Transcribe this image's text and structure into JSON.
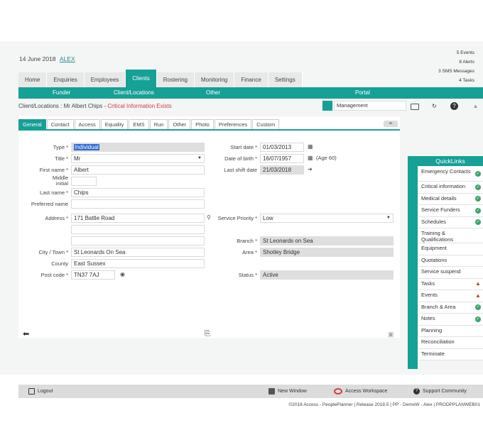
{
  "header": {
    "date": "14 June 2018",
    "user": "ALEX",
    "alerts": [
      "5 Events",
      "8 Alerts",
      "3 SMS Messages",
      "4 Tasks"
    ]
  },
  "nav": {
    "tabs": [
      "Home",
      "Enquiries",
      "Employees",
      "Clients",
      "Rostering",
      "Monitoring",
      "Finance",
      "Settings"
    ],
    "active": "Clients"
  },
  "subnav": {
    "funder": "Funder",
    "client_locations": "Client/Locations",
    "other": "Other",
    "portal": "Portal"
  },
  "breadcrumb": {
    "path": "Client/Locations : Mr Albert Chips - ",
    "critical": "Critical Information Exists"
  },
  "management": "Management",
  "subtabs": [
    "General",
    "Contact",
    "Access",
    "Equality",
    "EMS",
    "Run",
    "Other",
    "Photo",
    "Preferences",
    "Custom"
  ],
  "form": {
    "type_label": "Type *",
    "type_value": "Individual",
    "title_label": "Title *",
    "title_value": "Mr",
    "first_name_label": "First name *",
    "first_name_value": "Albert",
    "middle_label": "Middle",
    "initial_label": "initial",
    "last_name_label": "Last name *",
    "last_name_value": "Chips",
    "preferred_label": "Preferred name",
    "address_label": "Address *",
    "address_value": "171 Battle Road",
    "city_label": "City / Town *",
    "city_value": "St Leonards On Sea",
    "county_label": "County",
    "county_value": "East Sussex",
    "postcode_label": "Post code *",
    "postcode_value": "TN37 7AJ",
    "start_date_label": "Start date *",
    "start_date_value": "01/03/2013",
    "dob_label": "Date of birth *",
    "dob_value": "16/07/1957",
    "age": "(Age 60)",
    "last_shift_label": "Last shift date",
    "last_shift_value": "21/03/2018",
    "service_priority_label": "Service Priority *",
    "service_priority_value": "Low",
    "branch_label": "Branch *",
    "branch_value": "St Leonards on Sea",
    "area_label": "Area *",
    "area_value": "Shotley Bridge",
    "status_label": "Status *",
    "status_value": "Active"
  },
  "quicklinks": {
    "title": "QuickLinks",
    "items": [
      {
        "label": "Emergency Contacts",
        "status": "ok"
      },
      {
        "label": "Critical information",
        "status": "ok"
      },
      {
        "label": "Medical details",
        "status": "ok"
      },
      {
        "label": "Service Funders",
        "status": "ok"
      },
      {
        "label": "Schedules",
        "status": "ok"
      },
      {
        "label": "Training & Qualifications",
        "status": ""
      },
      {
        "label": "Equipment",
        "status": ""
      },
      {
        "label": "Quotations",
        "status": ""
      },
      {
        "label": "Service suspend",
        "status": ""
      },
      {
        "label": "Tasks",
        "status": "warn"
      },
      {
        "label": "Events",
        "status": "warn"
      },
      {
        "label": "Branch & Area",
        "status": "ok"
      },
      {
        "label": "Notes",
        "status": "ok"
      },
      {
        "label": "Planning",
        "status": ""
      },
      {
        "label": "Reconciliation",
        "status": ""
      },
      {
        "label": "Terminate",
        "status": ""
      }
    ]
  },
  "footer": {
    "logout": "Logout",
    "new_window": "New Window",
    "access_workspace": "Access Workspace",
    "support": "Support Community",
    "copyright": "©2018 Access - PeoplePlanner | Release 2018.5 | PP - DemoW - Alex | PRODPPLANWEB01"
  },
  "colors": {
    "accent": "#16a096",
    "critical": "#d23d3d",
    "ok": "#3aa56a"
  }
}
